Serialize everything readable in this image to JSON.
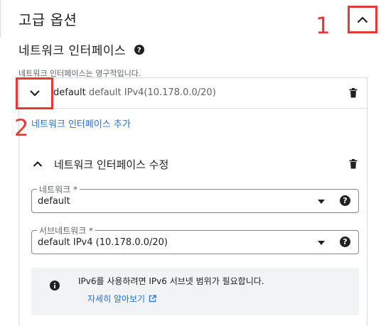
{
  "section": {
    "title": "고급 옵션",
    "toggle_icon": "chevron-up-icon"
  },
  "network_interfaces": {
    "heading": "네트워크 인터페이스",
    "info_text": "네트워크 인터페이스는 영구적입니다.",
    "rows": [
      {
        "name": "default",
        "detail": "default IPv4(10.178.0.0/20)"
      }
    ],
    "add_link": "네트워크 인터페이스 추가"
  },
  "edit_panel": {
    "title": "네트워크 인터페이스 수정",
    "network": {
      "label": "네트워크 *",
      "value": "default"
    },
    "subnetwork": {
      "label": "서브네트워크 *",
      "value": "default IPv4 (10.178.0.0/20)"
    },
    "notice": {
      "text": "IPv6를 사용하려면 IPv6 서브넷 범위가 필요합니다.",
      "link": "자세히 알아보기"
    }
  },
  "annotations": [
    {
      "label": "1",
      "color": "#e53935"
    },
    {
      "label": "2",
      "color": "#e53935"
    }
  ],
  "colors": {
    "link": "#1a73e8",
    "annotation": "#e53935",
    "notice_bg": "#f1f3f4"
  }
}
